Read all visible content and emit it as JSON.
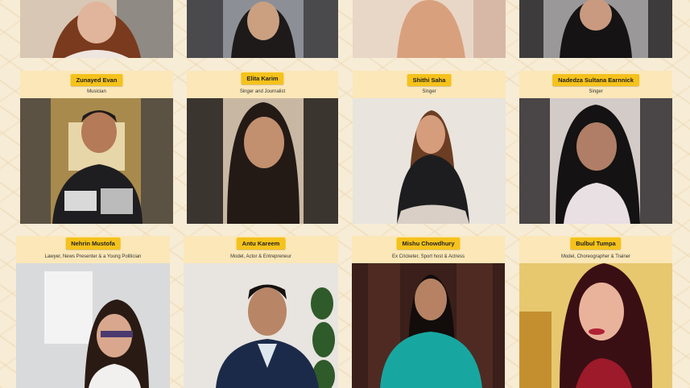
{
  "people": [
    {
      "name": "Zunayed Evan",
      "role": "Musician",
      "icon": "person-portrait"
    },
    {
      "name": "Elita Karim",
      "role": "Singer and Journalist",
      "icon": "person-portrait"
    },
    {
      "name": "Shithi Saha",
      "role": "Singer",
      "icon": "person-portrait"
    },
    {
      "name": "Nadedza Sultana Earnnick",
      "role": "Singer",
      "icon": "person-portrait"
    },
    {
      "name": "Nehrin Mustofa",
      "role": "Lawyer, News Presenter & a Young Politician",
      "icon": "person-portrait"
    },
    {
      "name": "Antu Kareem",
      "role": "Model, Actor & Entrepreneur",
      "icon": "person-portrait"
    },
    {
      "name": "Mishu Chowdhury",
      "role": "Ex Cricketer, Sport host & Actress",
      "icon": "person-portrait"
    },
    {
      "name": "Bulbul Tumpa",
      "role": "Model, Choreographer & Trainer",
      "icon": "person-portrait"
    }
  ],
  "colors": {
    "background": "#f7ecd6",
    "header": "#fbe7b8",
    "name_tag": "#f5c21b"
  }
}
